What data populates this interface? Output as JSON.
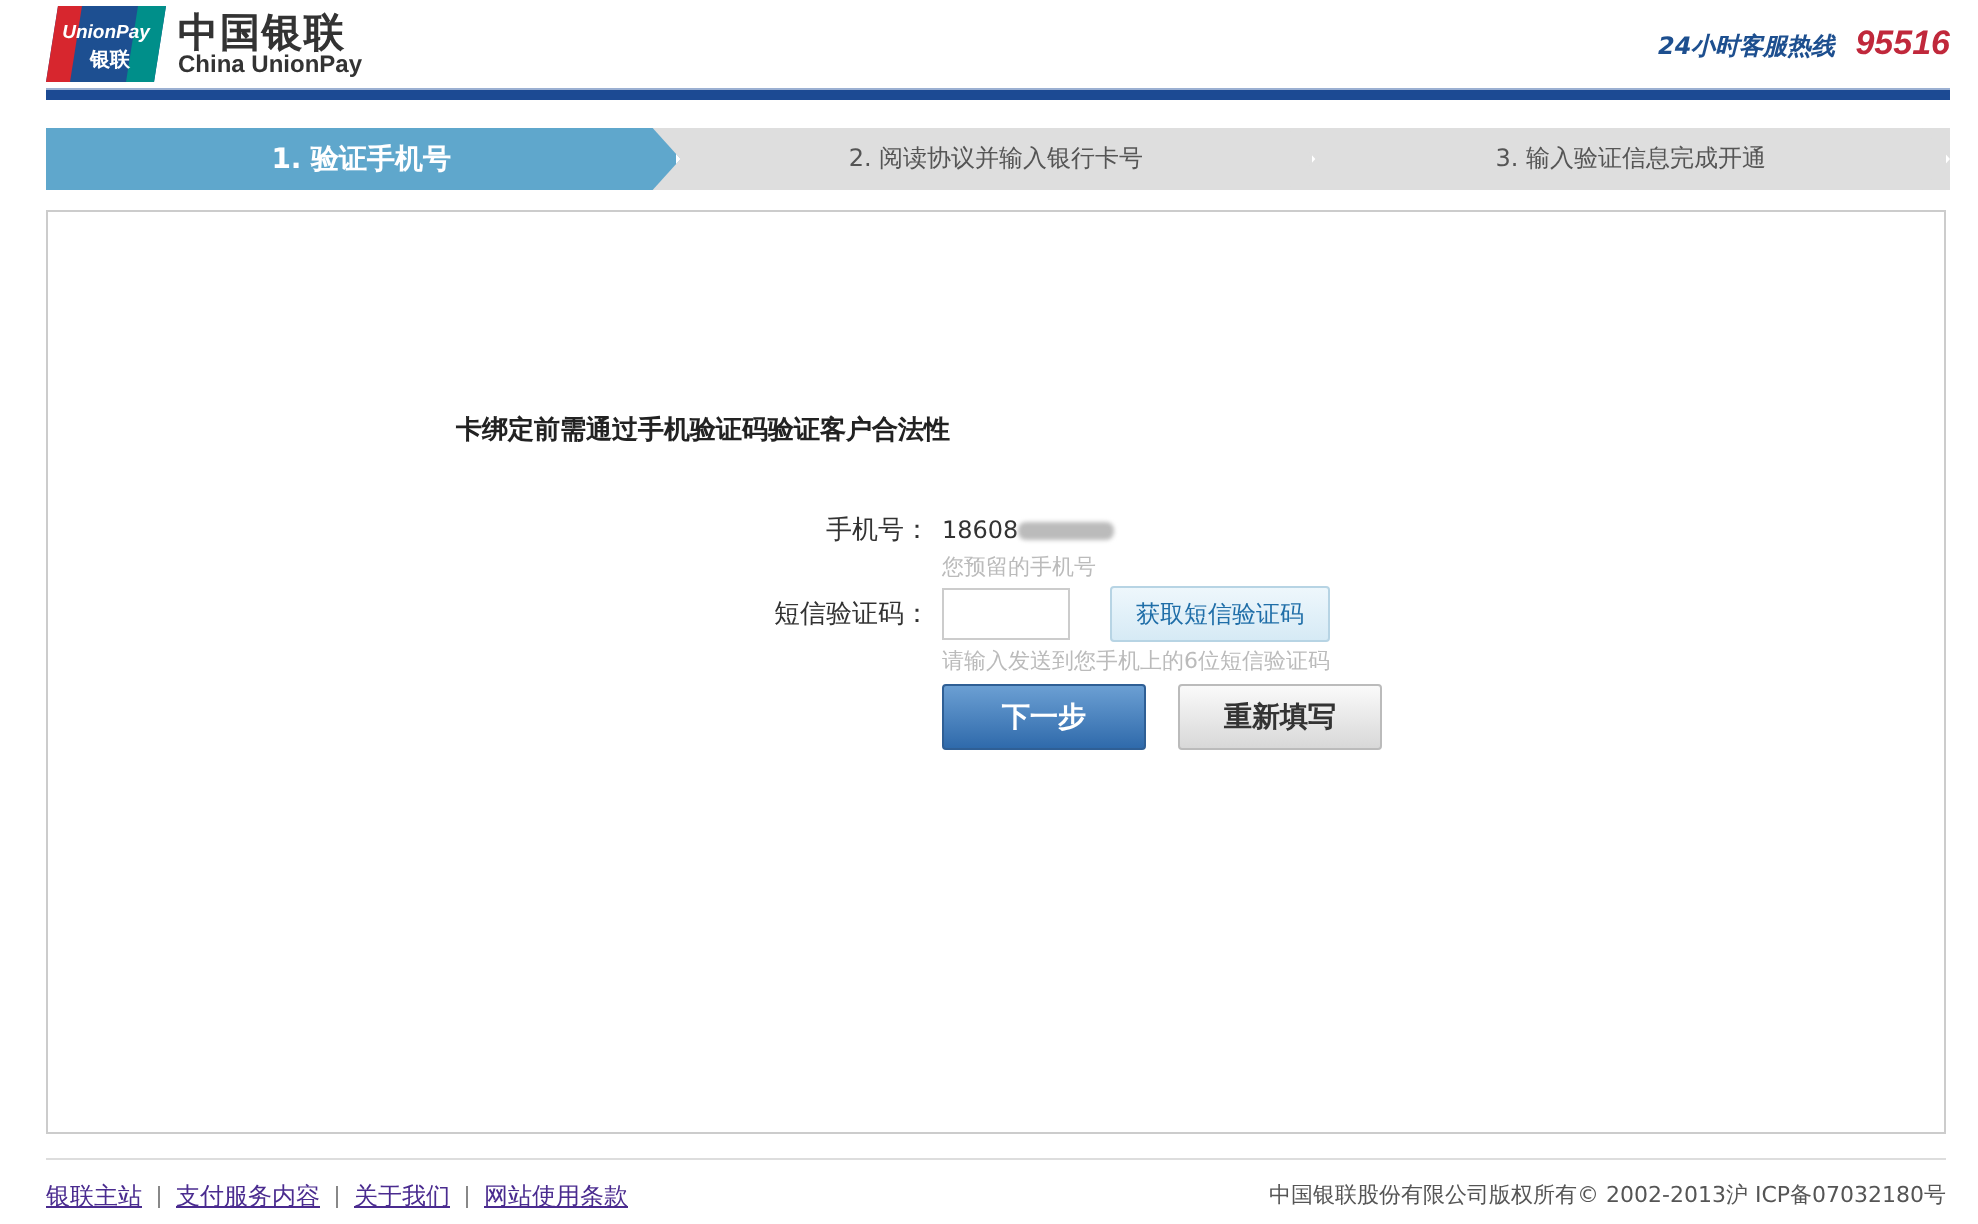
{
  "header": {
    "logo": {
      "mark_text": "UnionPay",
      "mark_subtext": "银联",
      "name_cn": "中国银联",
      "name_en": "China UnionPay"
    },
    "hotline_label": "24小时客服热线",
    "hotline_number": "95516"
  },
  "steps": [
    {
      "label": "1.  验证手机号",
      "selected": true
    },
    {
      "label": "2.  阅读协议并输入银行卡号",
      "selected": false
    },
    {
      "label": "3.  输入验证信息完成开通",
      "selected": false
    }
  ],
  "form": {
    "title": "卡绑定前需通过手机验证码验证客户合法性",
    "phone_label": "手机号：",
    "phone_value": "18608",
    "phone_hint": "您预留的手机号",
    "code_label": "短信验证码：",
    "get_code_button": "获取短信验证码",
    "code_hint": "请输入发送到您手机上的6位短信验证码",
    "buttons": [
      {
        "label": "下一步",
        "kind": "primary"
      },
      {
        "label": "重新填写",
        "kind": "secondary"
      }
    ]
  },
  "footer": {
    "links": [
      "银联主站",
      "支付服务内容",
      "关于我们",
      "网站使用条款"
    ],
    "copyright": "中国银联股份有限公司版权所有© 2002-2013沪 ICP备07032180号"
  }
}
